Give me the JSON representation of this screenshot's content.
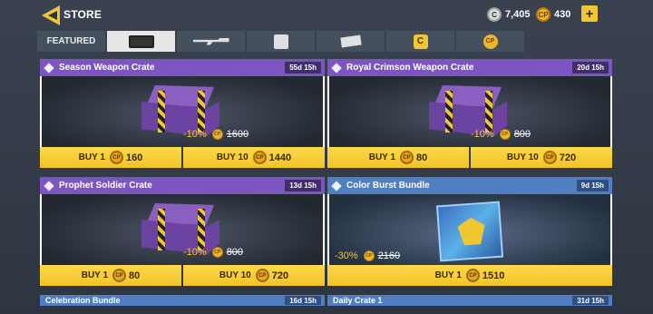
{
  "header": {
    "title": "STORE",
    "currencies": [
      {
        "icon": "cod-points-c-icon",
        "value": "7,405"
      },
      {
        "icon": "cp-coin-icon",
        "value": "430"
      }
    ],
    "plus_label": "+"
  },
  "tabs": [
    {
      "label": "FEATURED",
      "icon": null
    },
    {
      "label": "",
      "icon": "crate-icon",
      "active": true
    },
    {
      "label": "",
      "icon": "weapon-icon"
    },
    {
      "label": "",
      "icon": "character-icon"
    },
    {
      "label": "",
      "icon": "ticket-icon"
    },
    {
      "label": "",
      "icon": "c-currency-icon"
    },
    {
      "label": "",
      "icon": "cp-currency-icon"
    }
  ],
  "cards": [
    {
      "title": "Season Weapon Crate",
      "timer": "55d 15h",
      "discount": "-10%",
      "old_price": "1600",
      "buy1_label": "BUY 1",
      "buy1_price": "160",
      "buy10_label": "BUY 10",
      "buy10_price": "1440"
    },
    {
      "title": "Royal Crimson Weapon Crate",
      "timer": "20d 15h",
      "discount": "-10%",
      "old_price": "800",
      "buy1_label": "BUY 1",
      "buy1_price": "80",
      "buy10_label": "BUY 10",
      "buy10_price": "720"
    },
    {
      "title": "Prophet Soldier Crate",
      "timer": "13d 15h",
      "discount": "-10%",
      "old_price": "800",
      "buy1_label": "BUY 1",
      "buy1_price": "80",
      "buy10_label": "BUY 10",
      "buy10_price": "720"
    },
    {
      "title": "Color Burst Bundle",
      "timer": "9d 15h",
      "discount": "-30%",
      "old_price": "2160",
      "buy1_label": "BUY 1",
      "buy1_price": "1510"
    }
  ],
  "partial_cards": [
    {
      "title": "Celebration Bundle",
      "timer": "16d 15h"
    },
    {
      "title": "Daily Crate 1",
      "timer": "31d 15h"
    }
  ],
  "coin_label": "CP",
  "colors": {
    "accent_yellow": "#f2c631",
    "header_purple": "#7d55c0",
    "header_blue": "#4f7ec1"
  }
}
